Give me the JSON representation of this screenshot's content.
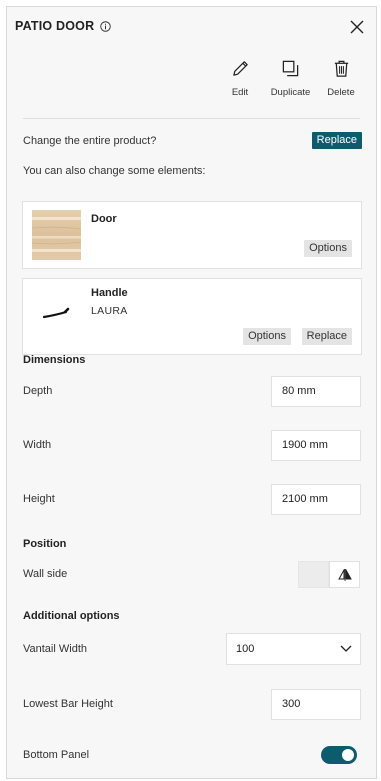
{
  "header": {
    "title": "PATIO DOOR"
  },
  "actions": [
    {
      "label": "Edit",
      "icon": "pencil-icon"
    },
    {
      "label": "Duplicate",
      "icon": "duplicate-icon"
    },
    {
      "label": "Delete",
      "icon": "trash-icon"
    }
  ],
  "product": {
    "change_text": "Change the entire product?",
    "replace_label": "Replace",
    "also_text": "You can also change some elements:"
  },
  "elements": {
    "door": {
      "name": "Door",
      "options_label": "Options"
    },
    "handle": {
      "name": "Handle",
      "model": "LAURA",
      "options_label": "Options",
      "replace_label": "Replace"
    }
  },
  "dimensions": {
    "title": "Dimensions",
    "depth": {
      "label": "Depth",
      "value": "80 mm"
    },
    "width": {
      "label": "Width",
      "value": "1900 mm"
    },
    "height": {
      "label": "Height",
      "value": "2100 mm"
    }
  },
  "position": {
    "title": "Position",
    "wall_side_label": "Wall side"
  },
  "additional": {
    "title": "Additional options",
    "vantail_width": {
      "label": "Vantail Width",
      "value": "100"
    },
    "lowest_bar_height": {
      "label": "Lowest Bar Height",
      "value": "300"
    },
    "bottom_panel": {
      "label": "Bottom Panel",
      "enabled": true
    }
  },
  "colors": {
    "accent": "#0d5c6e",
    "panel_bg": "#f7f7f7",
    "chip_bg": "#e4e4e4"
  }
}
